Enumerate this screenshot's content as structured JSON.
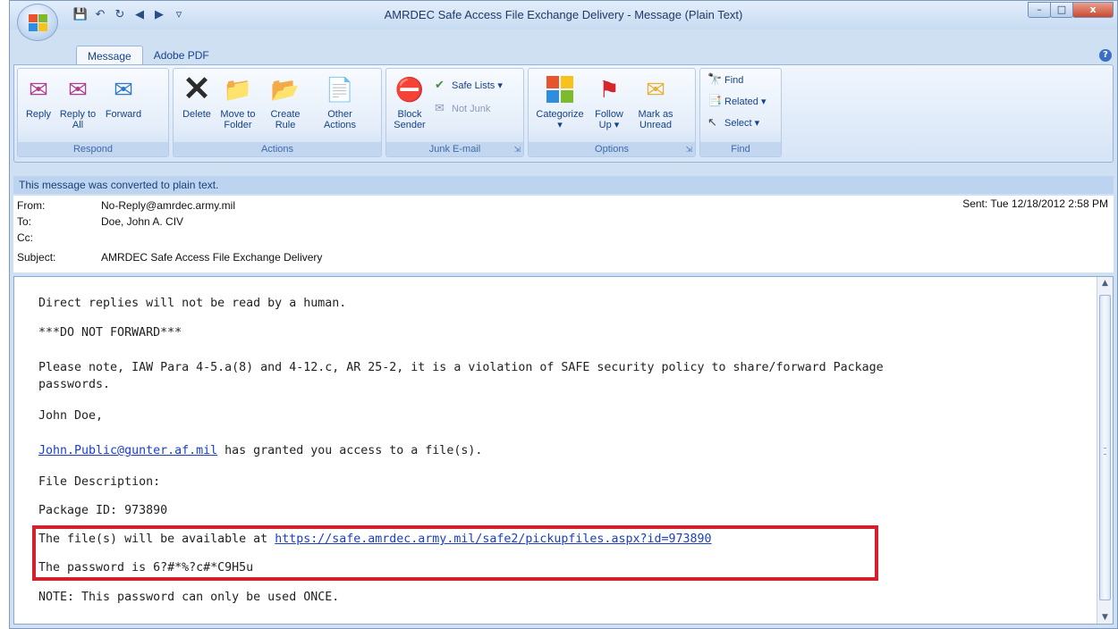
{
  "window": {
    "title": "AMRDEC Safe Access File Exchange Delivery - Message (Plain Text)",
    "controls": {
      "minimize": "–",
      "maximize": "□",
      "close": "x"
    },
    "help": "?"
  },
  "quick_access": [
    "save-icon",
    "undo-icon",
    "redo-icon",
    "previous-icon",
    "next-icon",
    "customize-icon"
  ],
  "tabs": [
    {
      "label": "Message",
      "active": true
    },
    {
      "label": "Adobe PDF",
      "active": false
    }
  ],
  "ribbon": {
    "groups": [
      {
        "title": "Respond",
        "buttons": [
          {
            "label": "Reply",
            "icon": "reply-icon"
          },
          {
            "label": "Reply to All",
            "icon": "reply-all-icon"
          },
          {
            "label": "Forward",
            "icon": "forward-icon"
          }
        ]
      },
      {
        "title": "Actions",
        "buttons": [
          {
            "label": "Delete",
            "icon": "delete-icon"
          },
          {
            "label": "Move to Folder",
            "icon": "move-to-folder-icon"
          },
          {
            "label": "Create Rule",
            "icon": "create-rule-icon"
          },
          {
            "label": "Other Actions",
            "icon": "other-actions-icon"
          }
        ]
      },
      {
        "title": "Junk E-mail",
        "buttons": [
          {
            "label": "Block Sender",
            "icon": "block-sender-icon"
          },
          {
            "label": "Safe Lists",
            "icon": "safe-lists-icon"
          },
          {
            "label": "Not Junk",
            "icon": "not-junk-icon"
          }
        ]
      },
      {
        "title": "Options",
        "buttons": [
          {
            "label": "Categorize",
            "icon": "categorize-icon"
          },
          {
            "label": "Follow Up",
            "icon": "follow-up-flag-icon"
          },
          {
            "label": "Mark as Unread",
            "icon": "mark-unread-icon"
          }
        ]
      },
      {
        "title": "Find",
        "buttons": [
          {
            "label": "Find",
            "icon": "find-icon"
          },
          {
            "label": "Related",
            "icon": "related-icon"
          },
          {
            "label": "Select",
            "icon": "select-icon"
          }
        ]
      }
    ]
  },
  "infobar": "This message was converted to plain text.",
  "headers": {
    "from_label": "From:",
    "from": "No-Reply@amrdec.army.mil",
    "to_label": "To:",
    "to": "Doe, John A. CIV",
    "cc_label": "Cc:",
    "cc": "",
    "subject_label": "Subject:",
    "subject": "AMRDEC Safe Access File Exchange Delivery",
    "sent": "Sent:  Tue 12/18/2012 2:58 PM"
  },
  "body": {
    "line1": "Direct replies will not be read by a human.",
    "line2": "***DO NOT FORWARD***",
    "line3a": "Please note, IAW Para 4-5.a(8) and 4-12.c, AR 25-2, it is a violation of SAFE security policy to share/forward Package",
    "line3b": "passwords.",
    "greeting": "John Doe,",
    "sender_email": "John.Public@gunter.af.mil",
    "granted": " has granted you access to a file(s).",
    "file_desc": "File Description:",
    "package": "Package ID: 973890",
    "avail_prefix": "The file(s) will be available at ",
    "avail_url": "https://safe.amrdec.army.mil/safe2/pickupfiles.aspx?id=973890",
    "password": "The password is 6?#*%?c#*C9H5u",
    "note": "NOTE: This password can only be used ONCE."
  },
  "colors": {
    "highlight_box": "#d41f2c",
    "link": "#1a40c0",
    "infobar": "#bcd4ef"
  }
}
